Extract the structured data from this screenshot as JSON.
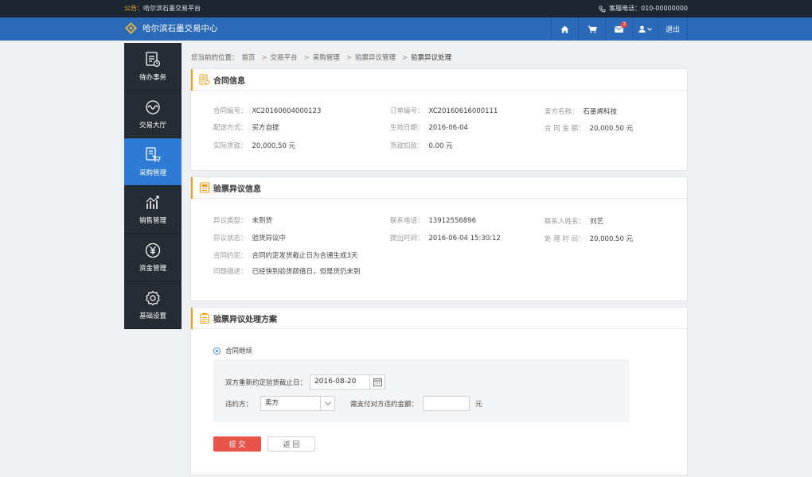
{
  "notice": {
    "label": "公告：",
    "text": "哈尔滨石墨交易平台",
    "hotline": "客服电话：010-00000000"
  },
  "header": {
    "site_name": "哈尔滨石墨交易中心",
    "mail_count": "3",
    "logout": "退出"
  },
  "sidebar": {
    "items": [
      {
        "label": "待办事务",
        "icon": "todo-icon"
      },
      {
        "label": "交易大厅",
        "icon": "trade-hall-icon"
      },
      {
        "label": "采购管理",
        "icon": "purchase-cart-icon",
        "active": true
      },
      {
        "label": "销售管理",
        "icon": "sales-chart-icon"
      },
      {
        "label": "资金管理",
        "icon": "yuan-icon"
      },
      {
        "label": "基础设置",
        "icon": "gear-icon"
      }
    ]
  },
  "breadcrumb": {
    "prefix": "您当前的位置：",
    "items": [
      "首页",
      "交易平台",
      "采购管理",
      "验票异议管理",
      "验票异议处理"
    ]
  },
  "contract": {
    "title": "合同信息",
    "fields": [
      {
        "key": "合同编号：",
        "value": "XC20160604000123"
      },
      {
        "key": "订单编号：",
        "value": "XC20160616000111"
      },
      {
        "key": "卖方名称：",
        "value": "石墨烯科技"
      },
      {
        "key": "配送方式：",
        "value": "买方自提"
      },
      {
        "key": "生效日期：",
        "value": "2016-06-04"
      },
      {
        "key": "合 同 金 额：",
        "value": "20,000.50 元"
      },
      {
        "key": "实际货款：",
        "value": "20,000.50 元"
      },
      {
        "key": "货款扣款：",
        "value": "0.00 元"
      }
    ]
  },
  "objection": {
    "title": "验票异议信息",
    "fields": [
      {
        "key": "异议类型：",
        "value": "未到货"
      },
      {
        "key": "联系电话：",
        "value": "13912556896"
      },
      {
        "key": "联系人姓名：",
        "value": "刘艺"
      },
      {
        "key": "异议状态：",
        "value": "验货异议中"
      },
      {
        "key": "提出时间：",
        "value": "2016-06-04 15:30:12"
      },
      {
        "key": "处 理 时 间：",
        "value": "20,000.50 元"
      },
      {
        "key": "合同约定：",
        "value": "合同约定发货截止日为合通生成3天"
      },
      {
        "key": "问题描述：",
        "value": "已经快到验货颜值日，但是货仍未到"
      }
    ]
  },
  "plan": {
    "title": "验票异议处理方案",
    "option": "合同继续",
    "date_label": "双方重新约定验货截止日：",
    "date_value": "2016-08-20",
    "breach_label": "违约方：",
    "breach_value": "卖方",
    "amount_label": "需支付对方违约金额：",
    "amount_value": "",
    "amount_unit": "元",
    "submit": "提 交",
    "back": "返 回"
  },
  "colors": {
    "header": "#2a6ab9",
    "sidebar": "#252c34",
    "active": "#2f7ad4",
    "accent": "#f39c12",
    "submit": "#e9544a"
  }
}
